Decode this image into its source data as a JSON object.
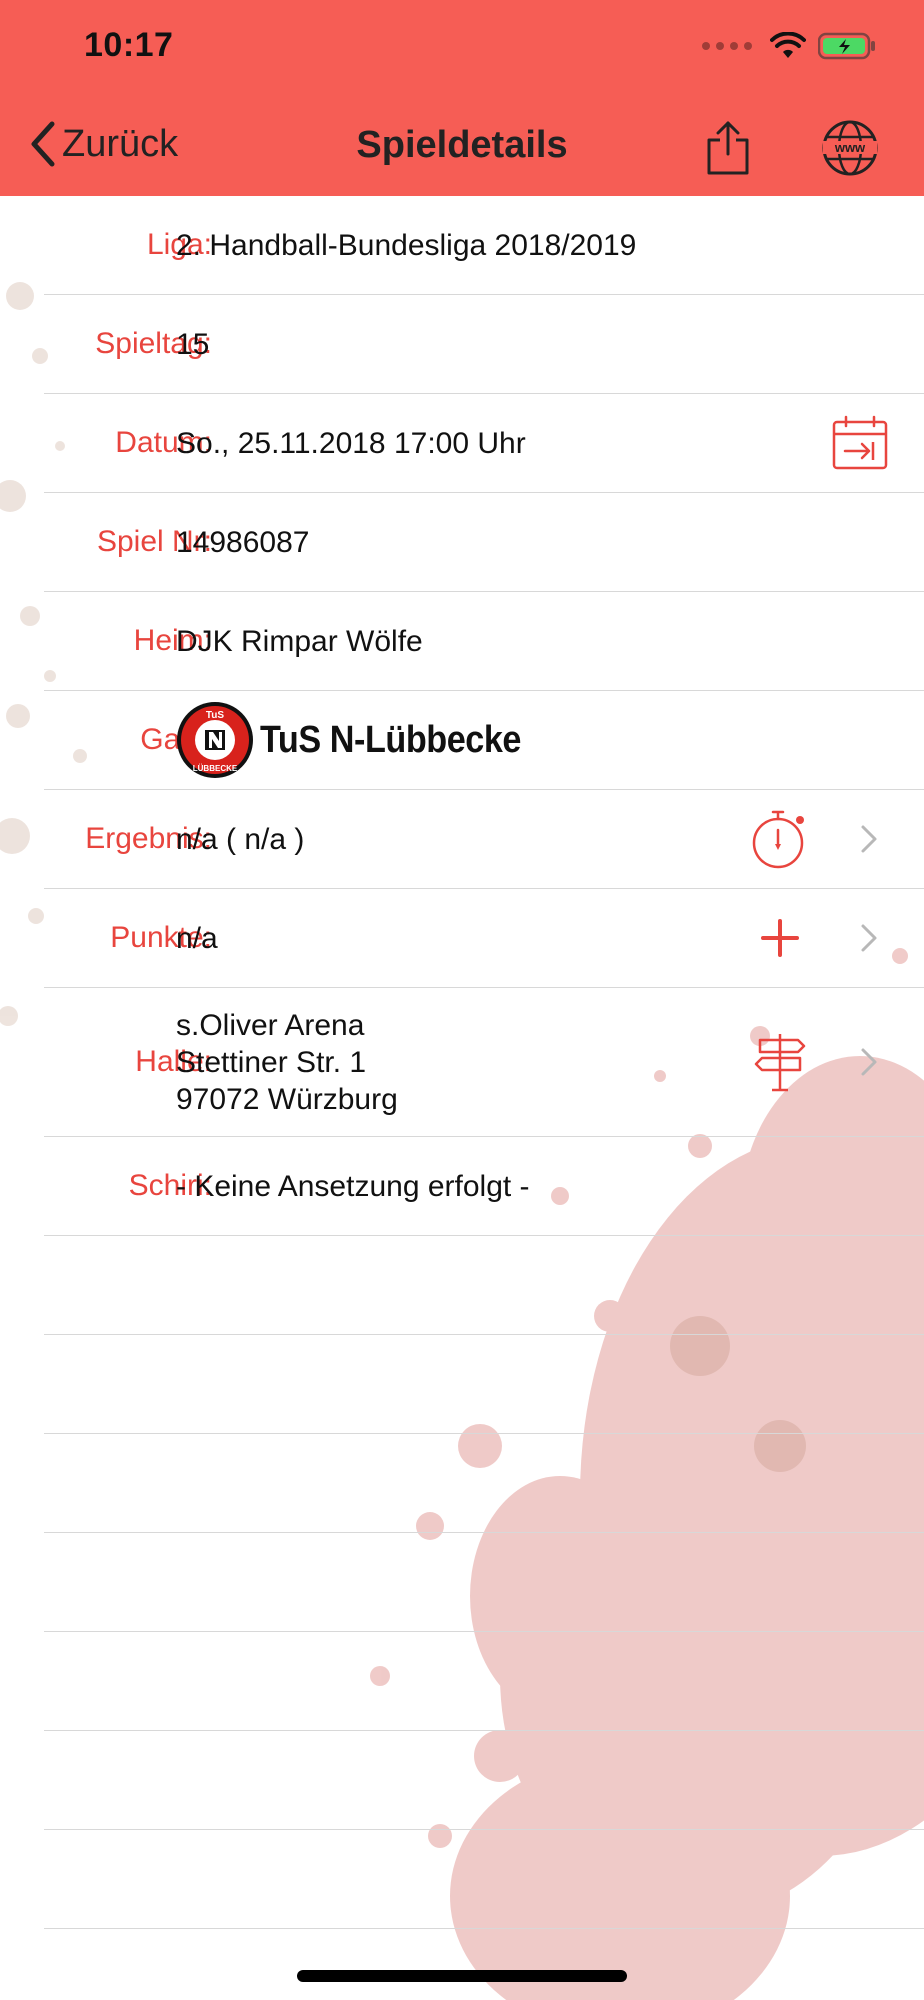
{
  "status_bar": {
    "time": "10:17"
  },
  "nav": {
    "back_label": "Zurück",
    "title": "Spieldetails"
  },
  "details": {
    "liga": {
      "label": "Liga:",
      "value": "2. Handball-Bundesliga 2018/2019"
    },
    "spieltag": {
      "label": "Spieltag:",
      "value": "15"
    },
    "datum": {
      "label": "Datum:",
      "value": "So., 25.11.2018 17:00 Uhr"
    },
    "spielnr": {
      "label": "Spiel Nr:",
      "value": "14986087"
    },
    "heim": {
      "label": "Heim:",
      "value": "DJK Rimpar Wölfe"
    },
    "gast": {
      "label": "Gast:",
      "value": "TuS N-Lübbecke",
      "logo_text_top": "TuS",
      "logo_text_bottom": "LÜBBECKE"
    },
    "ergebnis": {
      "label": "Ergebnis:",
      "value": "n/a  ( n/a )"
    },
    "punkte": {
      "label": "Punkte:",
      "value": "n/a"
    },
    "halle": {
      "label": "Halle:",
      "line1": "s.Oliver Arena",
      "line2": "Stettiner Str. 1",
      "line3": "97072 Würzburg"
    },
    "schiri": {
      "label": "Schiri:",
      "value": "- Keine Ansetzung erfolgt -"
    }
  },
  "colors": {
    "accent": "#f65d55",
    "label": "#e8453e"
  }
}
